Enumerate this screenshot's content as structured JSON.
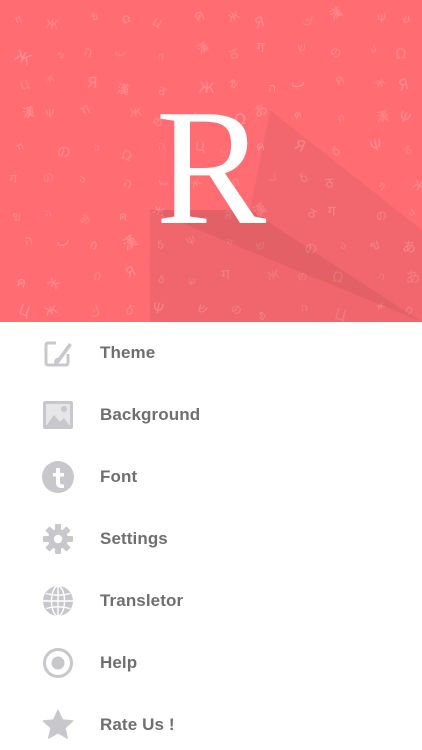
{
  "header": {
    "logo_letter": "R",
    "background_color": "#ff6d73",
    "pattern_glyphs": [
      "ग",
      "ש",
      "Ж",
      "の",
      "ა",
      "ข",
      "Ω",
      "ה",
      "あ",
      "Ц",
      "ب",
      "ค",
      "ж",
      "ი",
      "Я",
      "ك",
      "漢",
      "δ",
      "Ψ",
      "ठ"
    ]
  },
  "menu": {
    "items": [
      {
        "id": "theme",
        "label": "Theme",
        "icon": "theme-icon"
      },
      {
        "id": "background",
        "label": "Background",
        "icon": "image-icon"
      },
      {
        "id": "font",
        "label": "Font",
        "icon": "font-icon"
      },
      {
        "id": "settings",
        "label": "Settings",
        "icon": "gear-icon"
      },
      {
        "id": "translator",
        "label": "Transletor",
        "icon": "globe-icon"
      },
      {
        "id": "help",
        "label": "Help",
        "icon": "help-icon"
      },
      {
        "id": "rate",
        "label": "Rate Us !",
        "icon": "star-icon"
      }
    ],
    "icon_color": "#c8c8cc",
    "label_color": "#6f6f6f"
  }
}
